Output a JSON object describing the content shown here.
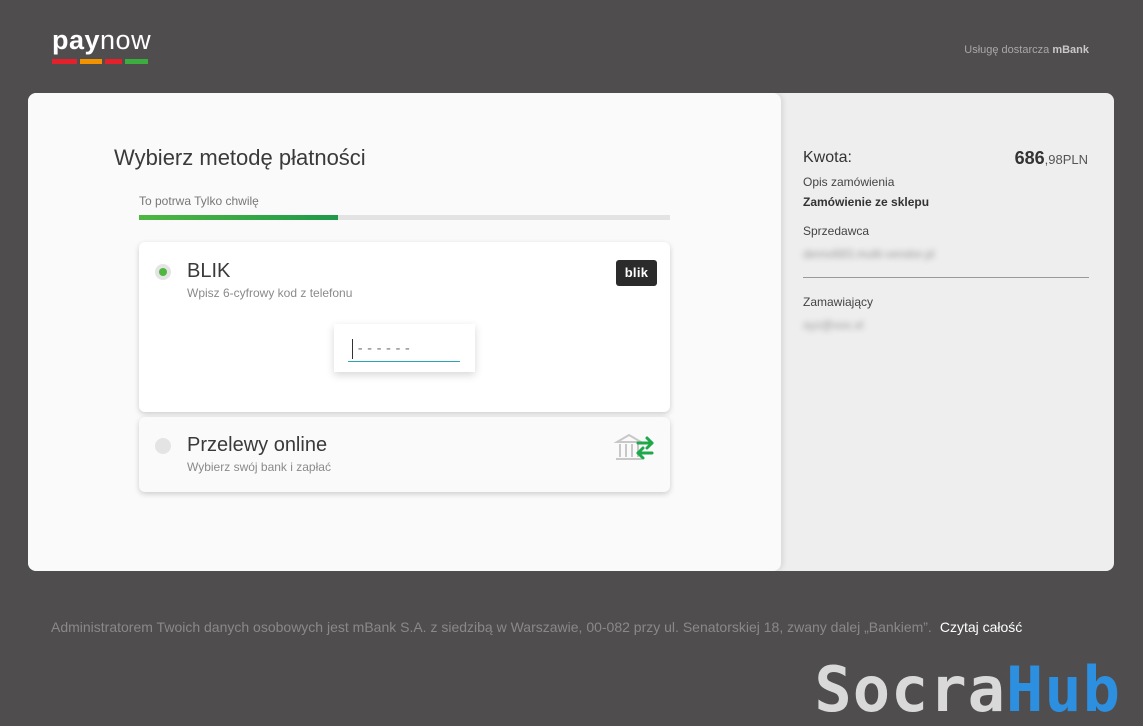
{
  "header": {
    "logo_pay": "pay",
    "logo_now": "now",
    "logo_colors": [
      "#e4202a",
      "#2b2b2b",
      "#f39200",
      "#e4202a",
      "#3cae3f"
    ],
    "provider_prefix": "Usługę dostarcza",
    "provider_name": "mBank"
  },
  "main": {
    "title": "Wybierz metodę płatności",
    "progress_label": "To potrwa Tylko chwilę",
    "progress_fraction": 0.375,
    "methods": [
      {
        "name": "BLIK",
        "description": "Wpisz 6-cyfrowy kod z telefonu",
        "selected": true,
        "badge": "blik",
        "code_placeholder": "------"
      },
      {
        "name": "Przelewy online",
        "description": "Wybierz swój bank i zapłać",
        "selected": false,
        "icon": "bank-transfer-icon"
      }
    ]
  },
  "summary": {
    "amount_label": "Kwota:",
    "amount_main": "686",
    "amount_fraction": ",98",
    "currency": "PLN",
    "order_label": "Opis zamówienia",
    "order_value": "Zamówienie ze sklepu",
    "seller_label": "Sprzedawca",
    "seller_value": "demo683.multi-vendor.pl",
    "buyer_label": "Zamawiający",
    "buyer_value": "xyz@xxx.xl"
  },
  "footer": {
    "text": "Administratorem Twoich danych osobowych jest mBank S.A. z siedzibą w Warszawie, 00-082 przy ul. Senatorskiej 18, zwany dalej „Bankiem”.",
    "link": "Czytaj całość"
  },
  "watermark": {
    "part1": "Socra",
    "part2": "Hub",
    "color1": "#d9d9d9",
    "color2": "#2d8fe0"
  },
  "colors": {
    "background": "#4f4d4e",
    "accent_green": "#4fb740",
    "input_underline": "#2aa5b8"
  }
}
